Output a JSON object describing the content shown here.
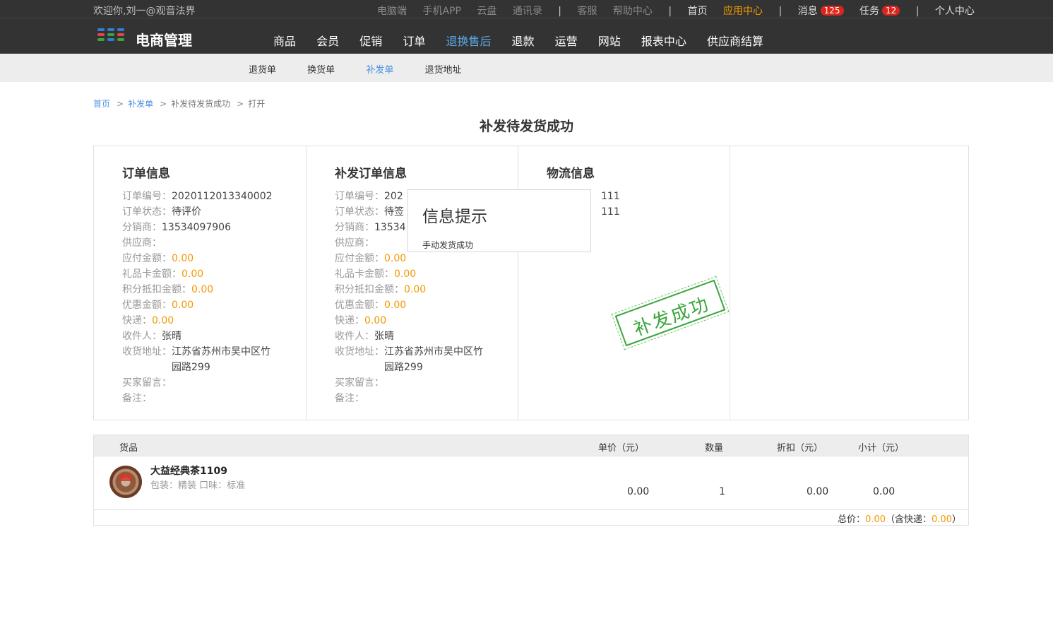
{
  "topbar": {
    "welcome": "欢迎你,刘一@观音法界",
    "links_dim": [
      "电脑端",
      "手机APP",
      "云盘",
      "通讯录"
    ],
    "links_dim2": [
      "客服",
      "帮助中心"
    ],
    "home": "首页",
    "app_center": "应用中心",
    "messages_label": "消息",
    "messages_count": "125",
    "tasks_label": "任务",
    "tasks_count": "12",
    "personal": "个人中心",
    "separator": "|"
  },
  "logo": {
    "text": "电商管理",
    "colors": [
      "#2f7fd8",
      "#e64545",
      "#3ba53b",
      "#f39800"
    ]
  },
  "mainnav": [
    "商品",
    "会员",
    "促销",
    "订单",
    "退换售后",
    "退款",
    "运营",
    "网站",
    "报表中心",
    "供应商结算"
  ],
  "subnav": [
    "退货单",
    "换货单",
    "补发单",
    "退货地址"
  ],
  "breadcrumb": {
    "home": "首页",
    "level1": "补发单",
    "level2": "补发待发货成功",
    "level3": "打开",
    "sep": ">"
  },
  "page_title": "补发待发货成功",
  "order_info": {
    "title": "订单信息",
    "order_no_k": "订单编号：",
    "order_no": "2020112013340002",
    "status_k": "订单状态：",
    "status": "待评价",
    "distributor_k": "分销商：",
    "distributor": "13534097906",
    "supplier_k": "供应商：",
    "supplier": "",
    "payable_k": "应付金额：",
    "payable": "0.00",
    "giftcard_k": "礼品卡金额：",
    "giftcard": "0.00",
    "points_k": "积分抵扣金额：",
    "points": "0.00",
    "discount_k": "优惠金额：",
    "discount": "0.00",
    "express_k": "快递：",
    "express": "0.00",
    "receiver_k": "收件人：",
    "receiver": "张晴",
    "address_k": "收货地址：",
    "address": "江苏省苏州市吴中区竹园路299",
    "buyer_note_k": "买家留言：",
    "buyer_note": "",
    "remark_k": "备注：",
    "remark": ""
  },
  "reissue_info": {
    "title": "补发订单信息",
    "order_no_k": "订单编号：",
    "order_no": "202",
    "status_k": "订单状态：",
    "status": "待签",
    "distributor_k": "分销商：",
    "distributor": "13534",
    "supplier_k": "供应商：",
    "supplier": "",
    "payable_k": "应付金额：",
    "payable": "0.00",
    "giftcard_k": "礼品卡金额：",
    "giftcard": "0.00",
    "points_k": "积分抵扣金额：",
    "points": "0.00",
    "discount_k": "优惠金额：",
    "discount": "0.00",
    "express_k": "快递：",
    "express": "0.00",
    "receiver_k": "收件人：",
    "receiver": "张晴",
    "address_k": "收货地址：",
    "address": "江苏省苏州市吴中区竹园路299",
    "buyer_note_k": "买家留言：",
    "buyer_note": "",
    "remark_k": "备注：",
    "remark": ""
  },
  "logistics_info": {
    "title": "物流信息",
    "value1": "111",
    "value2": "111"
  },
  "stamp": {
    "text": "补发成功",
    "color": "#3ba53b"
  },
  "popup": {
    "title": "信息提示",
    "message": "手动发货成功"
  },
  "goods": {
    "headers": {
      "item": "货品",
      "price": "单价（元）",
      "qty": "数量",
      "discount": "折扣（元）",
      "subtotal": "小计（元）"
    },
    "rows": [
      {
        "name": "大益经典茶1109",
        "spec": "包装：精装    口味：标准",
        "price": "0.00",
        "qty": "1",
        "discount": "0.00",
        "subtotal": "0.00"
      }
    ],
    "total_label": "总价：",
    "total": "0.00",
    "express_label": "（含快递：",
    "express": "0.00",
    "close": "）"
  },
  "colors": {
    "accent_orange": "#f39800",
    "link_blue": "#4a90e2",
    "badge_red": "#d9261c",
    "nav_dark": "#333333"
  }
}
